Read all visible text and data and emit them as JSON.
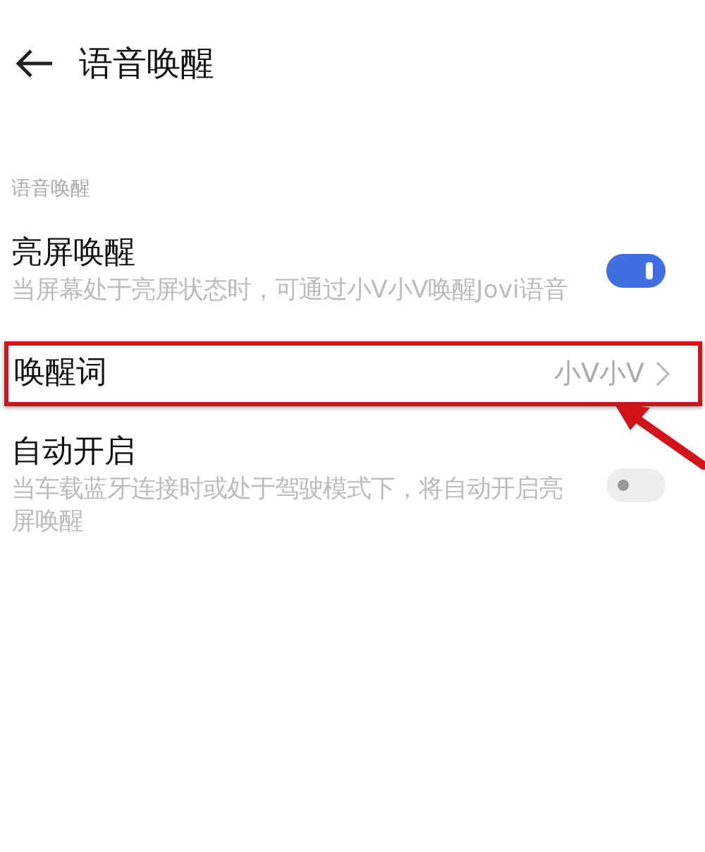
{
  "header": {
    "title": "语音唤醒"
  },
  "section": {
    "label": "语音唤醒"
  },
  "items": [
    {
      "kind": "toggle",
      "title": "亮屏唤醒",
      "description": "当屏幕处于亮屏状态时，可通过小V小V唤醒Jovi语音",
      "on": true,
      "highlighted": false
    },
    {
      "kind": "link",
      "title": "唤醒词",
      "value": "小V小V",
      "highlighted": true
    },
    {
      "kind": "toggle",
      "title": "自动开启",
      "description": "当车载蓝牙连接时或处于驾驶模式下，将自动开启亮屏唤醒",
      "on": false,
      "highlighted": false
    }
  ]
}
